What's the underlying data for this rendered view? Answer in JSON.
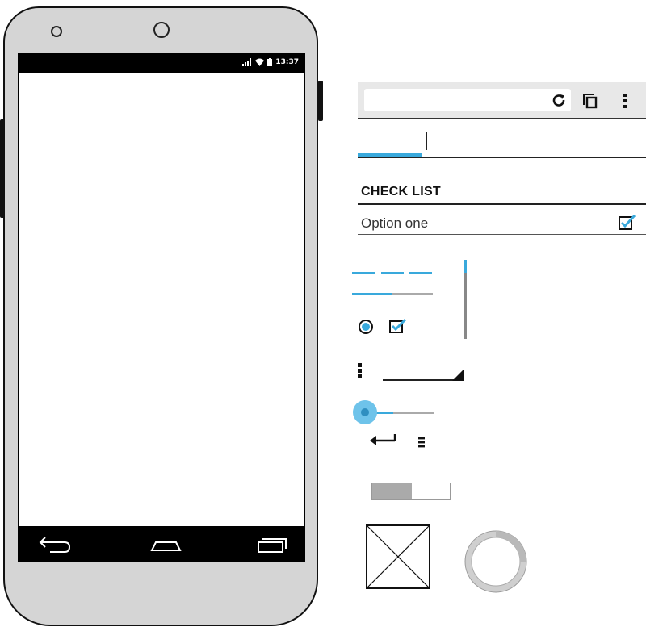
{
  "status_bar": {
    "time": "13:37",
    "icons": [
      "signal-icon",
      "wifi-icon",
      "battery-icon"
    ]
  },
  "nav_bar": {
    "icons": [
      "back-icon",
      "home-icon",
      "recent-apps-icon"
    ]
  },
  "browser_toolbar": {
    "url_value": "",
    "icons": [
      "reload-icon",
      "tabs-icon",
      "overflow-menu-icon"
    ]
  },
  "checklist": {
    "title": "CHECK LIST",
    "items": [
      {
        "label": "Option one",
        "checked": true
      }
    ]
  },
  "progress_bar": {
    "value_fraction": 0.5
  },
  "vertical_scrollbar": {
    "thumb_fraction": 0.16
  },
  "radio": {
    "selected": true
  },
  "checkbox": {
    "checked": true
  },
  "slider": {
    "value_fraction": 0.48
  },
  "toggle": {
    "on_fraction": 0.5
  },
  "colors": {
    "accent": "#39a9dc",
    "phone_body": "#d5d5d5",
    "screen": "#000000",
    "track_gray": "#aaaaaa"
  },
  "icons_misc": [
    "enter-icon",
    "list-icon",
    "dropdown-arrow-icon",
    "image-placeholder-icon",
    "spinner-ring-icon"
  ]
}
